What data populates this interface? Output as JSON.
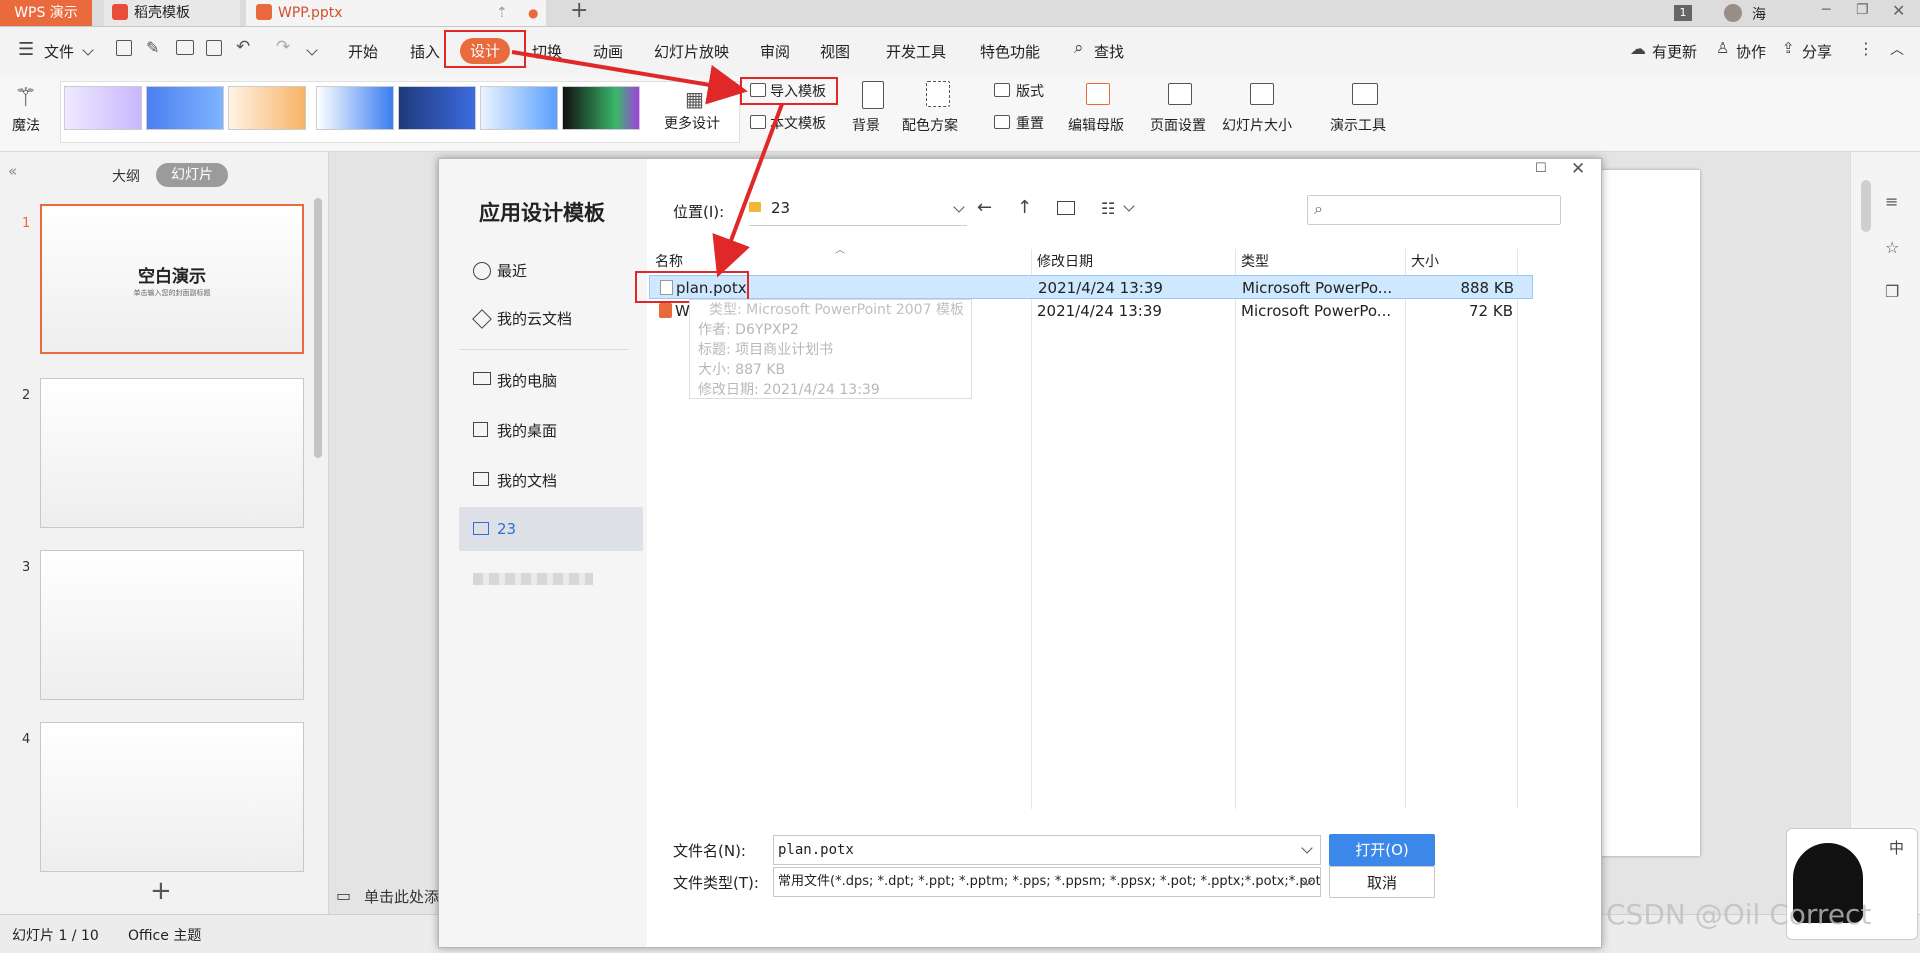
{
  "tabs": {
    "app": "WPS 演示",
    "template": "稻壳模板",
    "document": "WPP.pptx",
    "user": "海",
    "window_badge": "1"
  },
  "menu": {
    "file": "文件",
    "items": [
      "开始",
      "插入",
      "设计",
      "切换",
      "动画",
      "幻灯片放映",
      "审阅",
      "视图",
      "开发工具",
      "特色功能"
    ],
    "search": "查找",
    "update": "有更新",
    "collab": "协作",
    "share": "分享"
  },
  "ribbon": {
    "magic": "魔法",
    "more_design": "更多设计",
    "import_template": "导入模板",
    "this_template": "本文模板",
    "background": "背景",
    "color_scheme": "配色方案",
    "layout": "版式",
    "reset": "重置",
    "edit_master": "编辑母版",
    "page_setup": "页面设置",
    "slide_size": "幻灯片大小",
    "presentation_tools": "演示工具"
  },
  "leftpanel": {
    "outline": "大纲",
    "slides": "幻灯片",
    "slide1_title": "空白演示",
    "slide1_subtitle": "单击输入您的封面副标题",
    "slide_numbers": [
      "1",
      "2",
      "3",
      "4"
    ]
  },
  "dialog": {
    "title": "应用设计模板",
    "location_label": "位置(I):",
    "location_value": "23",
    "sidebar": [
      "最近",
      "我的云文档",
      "我的电脑",
      "我的桌面",
      "我的文档",
      "23"
    ],
    "columns": {
      "name": "名称",
      "modified": "修改日期",
      "type": "类型",
      "size": "大小"
    },
    "files": [
      {
        "name": "plan.potx",
        "modified": "2021/4/24 13:39",
        "type": "Microsoft PowerPo...",
        "size": "888 KB"
      },
      {
        "name": "WPP.pptx",
        "modified": "2021/4/24 13:39",
        "type": "Microsoft PowerPo...",
        "size": "72 KB"
      }
    ],
    "tooltip": {
      "line1": "类型: Microsoft PowerPoint 2007 模板",
      "line2": "作者: D6YPXP2",
      "line3": "标题: 项目商业计划书",
      "line4": "大小: 887 KB",
      "line5": "修改日期: 2021/4/24 13:39"
    },
    "filename_label": "文件名(N):",
    "filename_value": "plan.potx",
    "filetype_label": "文件类型(T):",
    "filetype_value": "常用文件(*.dps; *.dpt; *.ppt; *.pptm; *.pps; *.ppsm; *.ppsx; *.pot; *.pptx;*.potx;*.potm;*.thmx)",
    "open_button": "打开(O)",
    "cancel_button": "取消"
  },
  "notes": "单击此处添",
  "status": {
    "slide_count": "幻灯片 1 / 10",
    "theme": "Office 主题"
  },
  "ime": {
    "mode": "中"
  },
  "watermark": "CSDN @Oil Correct",
  "colors": {
    "accent": "#e96a3d",
    "highlight": "#cde8ff",
    "annotation_red": "#e02828",
    "primary_button": "#3c87ea"
  }
}
